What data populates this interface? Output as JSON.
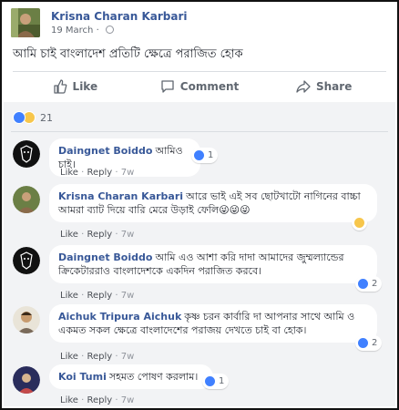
{
  "post": {
    "author": "Krisna Charan Karbari",
    "time": "19 March",
    "text": "আমি চাই বাংলাদেশ প্রতিটি ক্ষেত্রে পরাজিত হোক"
  },
  "actions": {
    "like": "Like",
    "comment": "Comment",
    "share": "Share"
  },
  "reactions": {
    "count": "21"
  },
  "comment_meta": {
    "like": "Like",
    "separator": "·",
    "reply": "Reply"
  },
  "comments": [
    {
      "author": "Daingnet Boiddo",
      "text": "আমিও চাই।",
      "time": "7w",
      "reaction_count": "1"
    },
    {
      "author": "Krisna Charan Karbari",
      "text": "আরে ভাই এই সব ছোটখাটো নাগিনের বাচ্চা আমরা ব্যাট দিয়ে বারি মেরে উড়াই ফেলি😜😜😜",
      "time": "7w",
      "reaction_count": ""
    },
    {
      "author": "Daingnet Boiddo",
      "text": "আমি এও আশা করি দাদা আমাদের জুম্মল্যান্ডের ক্রিকেটাররাও বাংলাদেশকে একদিন পরাজিত করবে।",
      "time": "7w",
      "reaction_count": "2"
    },
    {
      "author": "Aichuk Tripura Aichuk",
      "text": "কৃষ্ণ চরন কার্বারি দা আপনার সাথে আমি ও একমত সকল ক্ষেত্রে বাংলাদেশের পরাজয় দেখতে চাই বা হোক।",
      "time": "7w",
      "reaction_count": "2"
    },
    {
      "author": "Koi Tumi",
      "text": "সহমত পোষণ করলাম।",
      "time": "7w",
      "reaction_count": "1"
    }
  ],
  "colors": {
    "link_blue": "#385898",
    "like_blue": "#4080ff",
    "comments_bg": "#f2f3f5"
  },
  "icons": [
    "like-icon",
    "comment-icon",
    "share-icon",
    "like-reaction-icon",
    "haha-reaction-icon",
    "globe-icon"
  ]
}
